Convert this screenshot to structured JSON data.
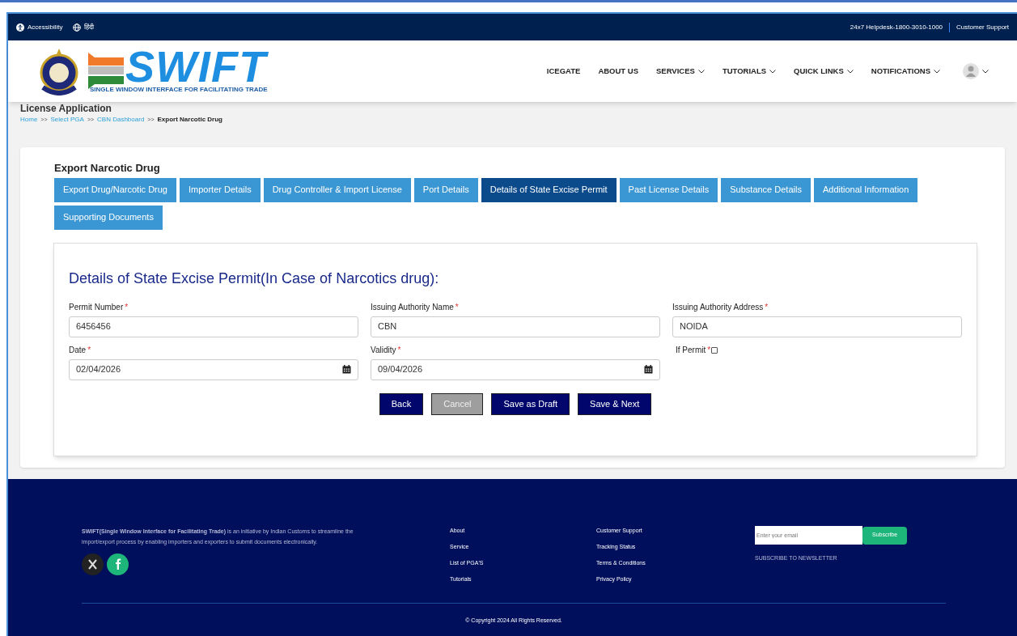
{
  "top_bar": {
    "links": [
      "Accessibility",
      "हिंदी"
    ],
    "helpdesk": "24x7 Helpdesk-1800-3010-1000",
    "support": "Customer Support"
  },
  "header": {
    "logo_text": "SWIFT",
    "logo_tagline": "SINGLE WINDOW INTERFACE FOR FACILITATING TRADE",
    "nav": [
      {
        "label": "ICEGATE",
        "dropdown": false
      },
      {
        "label": "ABOUT US",
        "dropdown": false
      },
      {
        "label": "SERVICES",
        "dropdown": true
      },
      {
        "label": "TUTORIALS",
        "dropdown": true
      },
      {
        "label": "QUICK LINKS",
        "dropdown": true
      },
      {
        "label": "NOTIFICATIONS",
        "dropdown": true
      }
    ]
  },
  "page_title": "License Application",
  "breadcrumb": [
    {
      "label": "Home",
      "current": false
    },
    {
      "label": "Select PGA",
      "current": false
    },
    {
      "label": "CBN Dashboard",
      "current": false
    },
    {
      "label": "Export Narcotic Drug",
      "current": true
    }
  ],
  "breadcrumb_separator": ">>",
  "card_title": "Export Narcotic Drug",
  "tabs": [
    {
      "label": "Export Drug/Narcotic Drug",
      "selected": false
    },
    {
      "label": "Importer Details",
      "selected": false
    },
    {
      "label": "Drug Controller & Import License",
      "selected": false
    },
    {
      "label": "Port Details",
      "selected": false
    },
    {
      "label": "Details of State Excise Permit",
      "selected": true
    },
    {
      "label": "Past License Details",
      "selected": false
    },
    {
      "label": "Substance Details",
      "selected": false
    },
    {
      "label": "Additional Information",
      "selected": false
    },
    {
      "label": "Supporting Documents",
      "selected": false
    }
  ],
  "form": {
    "title": "Details of State Excise Permit(In Case of Narcotics drug):",
    "required_mark": "*",
    "fields": [
      {
        "kind": "text",
        "label": "Permit Number",
        "required": true,
        "value": "6456456"
      },
      {
        "kind": "text",
        "label": "Issuing Authority Name",
        "required": true,
        "value": "CBN"
      },
      {
        "kind": "text",
        "label": "Issuing Authority Address",
        "required": true,
        "value": "NOIDA"
      },
      {
        "kind": "date",
        "label": "Date",
        "required": true,
        "value": "02/04/2026"
      },
      {
        "kind": "date",
        "label": "Validity",
        "required": true,
        "value": "09/04/2026"
      },
      {
        "kind": "checkbox",
        "label": "If Permit",
        "required": true,
        "checked": false
      }
    ],
    "buttons": [
      {
        "label": "Back",
        "disabled": false
      },
      {
        "label": "Cancel",
        "disabled": true
      },
      {
        "label": "Save as Draft",
        "disabled": false
      },
      {
        "label": "Save & Next",
        "disabled": false
      }
    ]
  },
  "footer": {
    "about": "**SWIFT(Single Window Interface for Facilitating Trade)** is an initiative by Indian Customs to streamline the import/export process by enabling importers and exporters to submit documents electronically.",
    "links_1": [
      "About",
      "Service",
      "List of PGA'S",
      "Tutorials"
    ],
    "links_2": [
      "Customer Support",
      "Tracking Status",
      "Terms & Conditions",
      "Privacy Policy"
    ],
    "email_placeholder": "Enter your email",
    "subscribe": "Subscribe",
    "newsletter": "SUBSCRIBE TO NEWSLETTER",
    "copyright": "© Copyright 2024 All Rights Reserved."
  }
}
